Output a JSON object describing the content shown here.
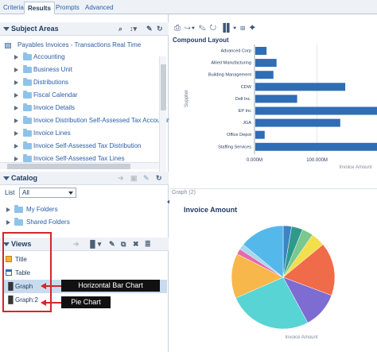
{
  "tabs": [
    "Criteria",
    "Results",
    "Prompts",
    "Advanced"
  ],
  "subject_areas": {
    "title": "Subject Areas",
    "root": "Payables Invoices - Transactions Real Time",
    "items": [
      "Accounting",
      "Business Unit",
      "Distributions",
      "Fiscal Calendar",
      "Invoice Details",
      "Invoice Distribution Self-Assessed Tax Accounting",
      "Invoice Lines",
      "Invoice Self-Assessed Tax Distribution",
      "Invoice Self-Assessed Tax Lines"
    ]
  },
  "catalog": {
    "title": "Catalog",
    "list_label": "List",
    "list_value": "All",
    "folders": [
      "My Folders",
      "Shared Folders"
    ]
  },
  "views": {
    "title": "Views",
    "items": [
      "Title",
      "Table",
      "Graph",
      "Graph:2"
    ],
    "selected": "Graph"
  },
  "callouts": {
    "bar": "Horizontal Bar Chart",
    "pie": "Pie Chart"
  },
  "compound_layout": "Compound Layout",
  "graph2_label": "Graph (2)",
  "chart_data": [
    {
      "type": "bar",
      "orientation": "horizontal",
      "xlabel": "Invoice Amount",
      "ylabel": "Supplier",
      "categories": [
        "Advanced Corp",
        "Allied Manufacturing",
        "Building Management",
        "CDW",
        "Dell Inc.",
        "EP Inc",
        "JGA",
        "Office Depot",
        "Staffing Services"
      ],
      "values": [
        18000000,
        34000000,
        29000000,
        144000000,
        67000000,
        200000000,
        136000000,
        15000000,
        200000000
      ],
      "xticks": [
        "0.000M",
        "100.000M"
      ],
      "xlim": [
        0,
        200000000
      ],
      "color": "#2f6db5",
      "grid": true
    },
    {
      "type": "pie",
      "title": "Invoice Amount",
      "xlabel": "Invoice Amount",
      "values": [
        3,
        4,
        4,
        5,
        19,
        13,
        30,
        16,
        2,
        2,
        16
      ],
      "colors": [
        "#3b84c6",
        "#2f9a8c",
        "#7ac78f",
        "#f3df4b",
        "#f06b4a",
        "#7d6cd1",
        "#58d4d4",
        "#f7b74a",
        "#e66aa9",
        "#a6d6f0",
        "#54b9ea"
      ]
    }
  ]
}
